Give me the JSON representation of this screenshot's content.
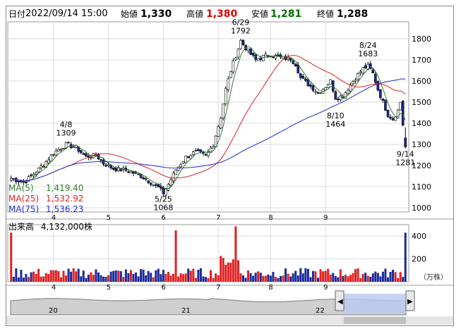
{
  "header": {
    "date_label": "日付",
    "datetime": "2022/09/14 15:00",
    "open_label": "始値",
    "open_value": "1,330",
    "high_label": "高値",
    "high_value": "1,380",
    "low_label": "安値",
    "low_value": "1,281",
    "close_label": "終値",
    "close_value": "1,288",
    "high_color": "#e00000",
    "low_color": "#007000"
  },
  "legend": {
    "ma5": {
      "label": "MA(5)",
      "value": "1,419.40",
      "color": "#2f7a2f"
    },
    "ma25": {
      "label": "MA(25)",
      "value": "1,532.92",
      "color": "#e02020"
    },
    "ma75": {
      "label": "MA(75)",
      "value": "1,536.23",
      "color": "#2030d0"
    }
  },
  "volume_panel": {
    "label": "出来高",
    "value": "4,132,000株",
    "unit": "（万株）",
    "ticks": [
      "400",
      "200"
    ]
  },
  "navigator": {
    "labels": [
      "20",
      "21",
      "22"
    ]
  },
  "chart_data": {
    "type": "candlestick",
    "month_labels": [
      "4",
      "5",
      "6",
      "7",
      "8",
      "9"
    ],
    "y_ticks": [
      1000,
      1100,
      1200,
      1300,
      1400,
      1500,
      1600,
      1700,
      1800
    ],
    "ylim": [
      980,
      1880
    ],
    "volume_ylim": [
      0,
      500
    ],
    "volume_unit": "万株",
    "annotations": [
      {
        "date": "4/8",
        "value": 1309
      },
      {
        "date": "5/25",
        "value": 1068
      },
      {
        "date": "6/29",
        "value": 1792
      },
      {
        "date": "8/10",
        "value": 1464
      },
      {
        "date": "8/24",
        "value": 1683
      },
      {
        "date": "9/14",
        "value": 1281
      }
    ],
    "anchors": [
      [
        0,
        1140
      ],
      [
        5,
        1120
      ],
      [
        9,
        1160
      ],
      [
        13,
        1205
      ],
      [
        17,
        1260
      ],
      [
        22,
        1300
      ],
      [
        26,
        1285
      ],
      [
        30,
        1240
      ],
      [
        34,
        1250
      ],
      [
        37,
        1210
      ],
      [
        41,
        1185
      ],
      [
        45,
        1180
      ],
      [
        48,
        1170
      ],
      [
        52,
        1150
      ],
      [
        56,
        1120
      ],
      [
        59,
        1095
      ],
      [
        61,
        1070
      ],
      [
        63,
        1110
      ],
      [
        66,
        1180
      ],
      [
        70,
        1240
      ],
      [
        74,
        1265
      ],
      [
        78,
        1245
      ],
      [
        81,
        1300
      ],
      [
        84,
        1430
      ],
      [
        86,
        1560
      ],
      [
        88,
        1650
      ],
      [
        90,
        1720
      ],
      [
        92,
        1790
      ],
      [
        95,
        1740
      ],
      [
        98,
        1700
      ],
      [
        101,
        1715
      ],
      [
        104,
        1725
      ],
      [
        108,
        1710
      ],
      [
        112,
        1705
      ],
      [
        114,
        1680
      ],
      [
        116,
        1615
      ],
      [
        120,
        1575
      ],
      [
        123,
        1545
      ],
      [
        126,
        1575
      ],
      [
        128,
        1600
      ],
      [
        130,
        1520
      ],
      [
        133,
        1530
      ],
      [
        137,
        1600
      ],
      [
        141,
        1660
      ],
      [
        143,
        1670
      ],
      [
        145,
        1635
      ],
      [
        147,
        1560
      ],
      [
        149,
        1500
      ],
      [
        151,
        1440
      ],
      [
        153,
        1420
      ],
      [
        155,
        1460
      ],
      [
        156,
        1500
      ],
      [
        158,
        1288
      ]
    ],
    "month_index": [
      17,
      39,
      61,
      83,
      104,
      126,
      148
    ],
    "volume_spikes": [
      [
        0,
        430
      ],
      [
        90,
        485
      ],
      [
        66,
        450
      ],
      [
        158,
        430
      ],
      [
        52,
        110
      ]
    ],
    "series": [
      {
        "name": "MA(5)",
        "window": 5,
        "last_value": 1419.4,
        "color": "#2f7a2f"
      },
      {
        "name": "MA(25)",
        "window": 25,
        "last_value": 1532.92,
        "color": "#e02020"
      },
      {
        "name": "MA(75)",
        "window": 75,
        "last_value": 1536.23,
        "color": "#2030d0"
      }
    ]
  }
}
